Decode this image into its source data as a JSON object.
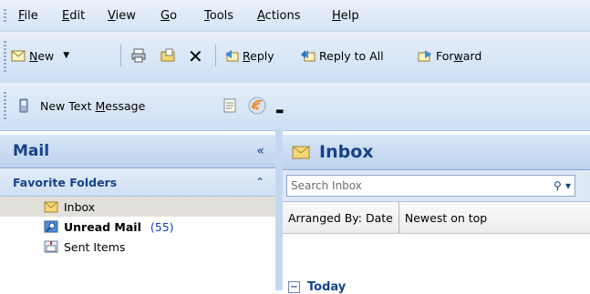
{
  "menubar": {
    "items": [
      {
        "pre": "",
        "u": "F",
        "post": "ile"
      },
      {
        "pre": "",
        "u": "E",
        "post": "dit"
      },
      {
        "pre": "",
        "u": "V",
        "post": "iew"
      },
      {
        "pre": "",
        "u": "G",
        "post": "o"
      },
      {
        "pre": "",
        "u": "T",
        "post": "ools"
      },
      {
        "pre": "",
        "u": "A",
        "post": "ctions"
      },
      {
        "pre": "",
        "u": "H",
        "post": "elp"
      }
    ]
  },
  "toolbar": {
    "new_u": "N",
    "new_rest": "ew",
    "reply_u": "R",
    "reply_rest": "eply",
    "reply_all": "Reply to All",
    "forward_pre": "For",
    "forward_u": "w",
    "forward_rest": "ard"
  },
  "toolbar2": {
    "new_text_pre": "New Text ",
    "new_text_u": "M",
    "new_text_post": "essage"
  },
  "nav": {
    "title": "Mail",
    "collapse": "«",
    "favorites_title": "Favorite Folders",
    "favorites_toggle": "⌃",
    "folders": [
      {
        "label": "Inbox",
        "count": ""
      },
      {
        "label": "Unread Mail",
        "count": "(55)"
      },
      {
        "label": "Sent Items",
        "count": ""
      }
    ]
  },
  "inbox": {
    "title": "Inbox",
    "search_placeholder": "Search Inbox",
    "arranged_by": "Arranged By: Date",
    "sort_order": "Newest on top",
    "group_label": "Today"
  }
}
